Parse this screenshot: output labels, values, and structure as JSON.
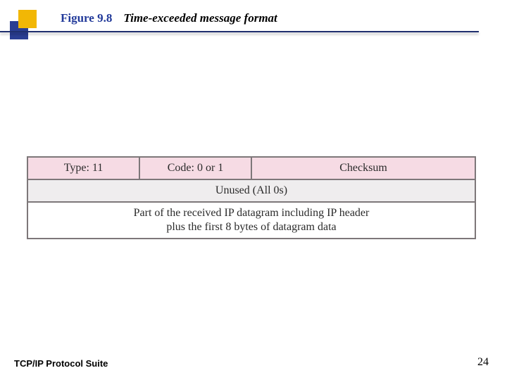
{
  "heading": {
    "figure_label": "Figure 9.8",
    "figure_title": "Time-exceeded message format"
  },
  "packet": {
    "row1": {
      "type": "Type: 11",
      "code": "Code: 0 or 1",
      "checksum": "Checksum"
    },
    "row2": "Unused (All 0s)",
    "row3": "Part of the received IP datagram including IP header\nplus the first 8 bytes of datagram data"
  },
  "footer": {
    "left": "TCP/IP Protocol Suite",
    "page_number": "24"
  }
}
